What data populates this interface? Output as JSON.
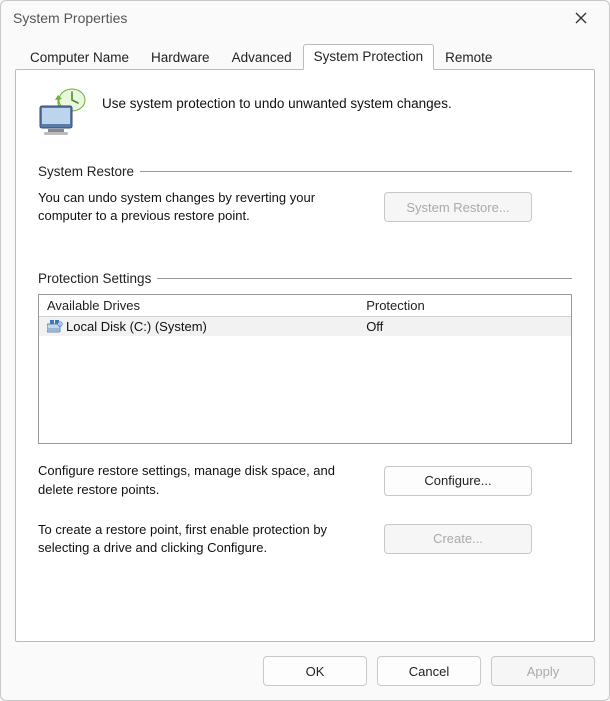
{
  "window": {
    "title": "System Properties"
  },
  "tabs": [
    {
      "label": "Computer Name"
    },
    {
      "label": "Hardware"
    },
    {
      "label": "Advanced"
    },
    {
      "label": "System Protection"
    },
    {
      "label": "Remote"
    }
  ],
  "active_tab_index": 3,
  "intro_text": "Use system protection to undo unwanted system changes.",
  "groups": {
    "restore": {
      "title": "System Restore",
      "desc": "You can undo system changes by reverting your computer to a previous restore point.",
      "button": "System Restore...",
      "button_enabled": false
    },
    "protection": {
      "title": "Protection Settings",
      "columns": {
        "drive": "Available Drives",
        "protection": "Protection"
      },
      "rows": [
        {
          "drive": "Local Disk (C:) (System)",
          "protection": "Off"
        }
      ],
      "configure_desc": "Configure restore settings, manage disk space, and delete restore points.",
      "configure_button": "Configure...",
      "create_desc": "To create a restore point, first enable protection by selecting a drive and clicking Configure.",
      "create_button": "Create...",
      "create_enabled": false
    }
  },
  "dialog_buttons": {
    "ok": "OK",
    "cancel": "Cancel",
    "apply": "Apply",
    "apply_enabled": false
  },
  "icons": {
    "restore_monitor": "restore-monitor-icon",
    "drive": "drive-icon"
  }
}
